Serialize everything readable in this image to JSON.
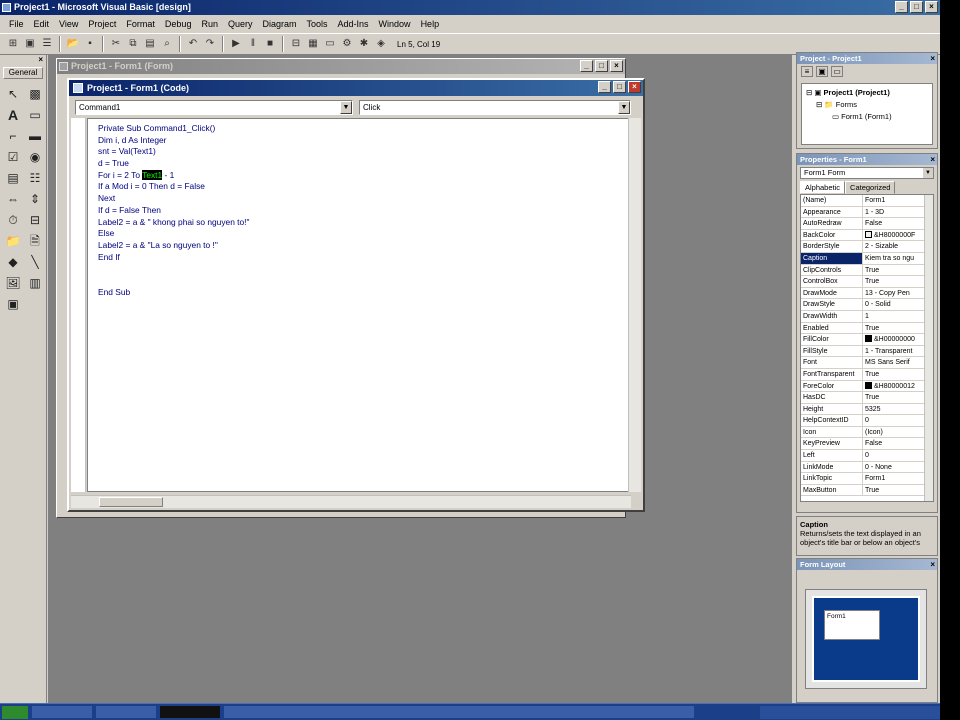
{
  "window": {
    "title": "Project1 - Microsoft Visual Basic [design]"
  },
  "menu": [
    "File",
    "Edit",
    "View",
    "Project",
    "Format",
    "Debug",
    "Run",
    "Query",
    "Diagram",
    "Tools",
    "Add-Ins",
    "Window",
    "Help"
  ],
  "toolbar": {
    "position": "Ln 5, Col 19"
  },
  "toolbox": {
    "tab": "General"
  },
  "form_window": {
    "title": "Project1 - Form1 (Form)"
  },
  "code_window": {
    "title": "Project1 - Form1 (Code)",
    "object_combo": "Command1",
    "proc_combo": "Click",
    "lines": [
      "Private Sub Command1_Click()",
      "Dim i, d As Integer",
      "snt = Val(Text1)",
      "d = True",
      {
        "before": "For i = 2 To ",
        "highlight": "Text1",
        "after": " - 1"
      },
      "If a Mod i = 0 Then d = False",
      "Next",
      "If d = False Then",
      "Label2 = a & \" khong phai so nguyen to!\"",
      "Else",
      "Label2 = a & \"La so nguyen to !\"",
      "End If",
      "",
      "",
      "End Sub"
    ]
  },
  "project_panel": {
    "title": "Project - Project1",
    "tree": [
      "Project1 (Project1)",
      "Forms",
      "Form1 (Form1)"
    ]
  },
  "properties_panel": {
    "title": "Properties - Form1",
    "object": "Form1 Form",
    "tabs": [
      "Alphabetic",
      "Categorized"
    ],
    "rows": [
      [
        "(Name)",
        "Form1"
      ],
      [
        "Appearance",
        "1 - 3D"
      ],
      [
        "AutoRedraw",
        "False"
      ],
      [
        "BackColor",
        "&H8000000F"
      ],
      [
        "BorderStyle",
        "2 - Sizable"
      ],
      [
        "Caption",
        "Kiem tra so ngu"
      ],
      [
        "ClipControls",
        "True"
      ],
      [
        "ControlBox",
        "True"
      ],
      [
        "DrawMode",
        "13 - Copy Pen"
      ],
      [
        "DrawStyle",
        "0 - Solid"
      ],
      [
        "DrawWidth",
        "1"
      ],
      [
        "Enabled",
        "True"
      ],
      [
        "FillColor",
        "&H00000000"
      ],
      [
        "FillStyle",
        "1 - Transparent"
      ],
      [
        "Font",
        "MS Sans Serif"
      ],
      [
        "FontTransparent",
        "True"
      ],
      [
        "ForeColor",
        "&H80000012"
      ],
      [
        "HasDC",
        "True"
      ],
      [
        "Height",
        "5325"
      ],
      [
        "HelpContextID",
        "0"
      ],
      [
        "Icon",
        "(Icon)"
      ],
      [
        "KeyPreview",
        "False"
      ],
      [
        "Left",
        "0"
      ],
      [
        "LinkMode",
        "0 - None"
      ],
      [
        "LinkTopic",
        "Form1"
      ],
      [
        "MaxButton",
        "True"
      ]
    ],
    "selected": "Caption"
  },
  "description": {
    "title": "Caption",
    "text": "Returns/sets the text displayed in an object's title bar or below an object's"
  },
  "form_layout": {
    "title": "Form Layout",
    "form_label": "Form1"
  }
}
